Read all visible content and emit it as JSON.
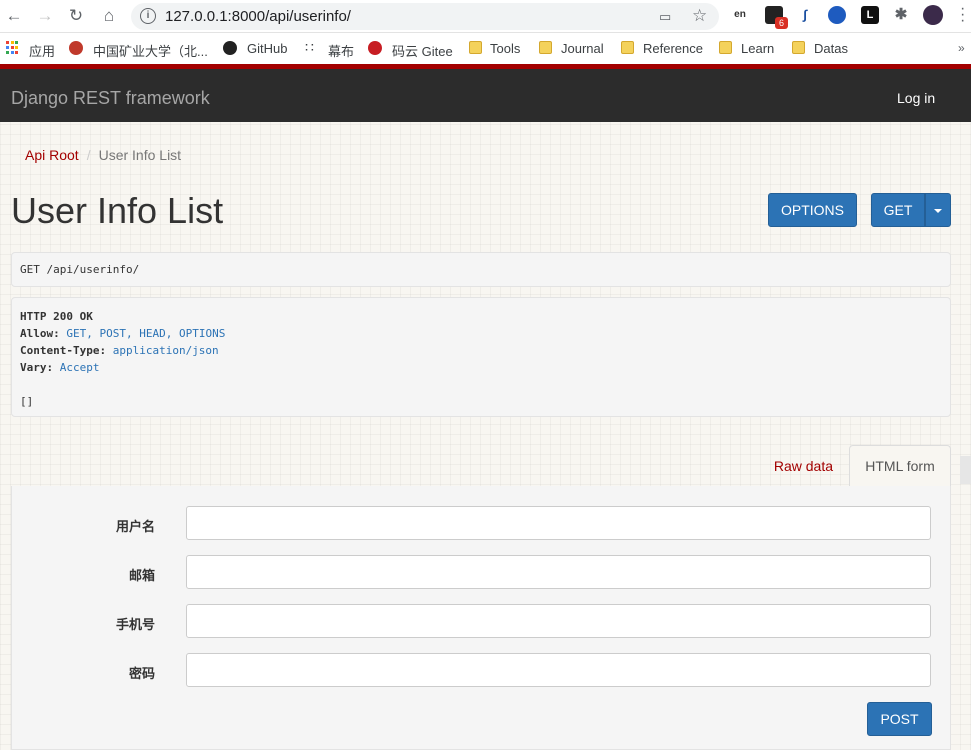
{
  "browser": {
    "url": "127.0.0.1:8000/api/userinfo/",
    "extension_badge": "6",
    "bookmarks": [
      "应用",
      "中国矿业大学（北...",
      "GitHub",
      "幕布",
      "码云 Gitee",
      "Tools",
      "Journal",
      "Reference",
      "Learn",
      "Datas"
    ]
  },
  "navbar": {
    "brand": "Django REST framework",
    "login": "Log in"
  },
  "breadcrumb": {
    "root": "Api Root",
    "separator": "/",
    "current": "User Info List"
  },
  "page_title": "User Info List",
  "buttons": {
    "options": "OPTIONS",
    "get": "GET",
    "post": "POST"
  },
  "request_line": "GET /api/userinfo/",
  "response": {
    "status": "HTTP 200 OK",
    "allow_key": "Allow:",
    "allow_val": "GET, POST, HEAD, OPTIONS",
    "ct_key": "Content-Type:",
    "ct_val": "application/json",
    "vary_key": "Vary:",
    "vary_val": "Accept",
    "body": "[]"
  },
  "tabs": {
    "raw": "Raw data",
    "html": "HTML form"
  },
  "form": {
    "fields": [
      {
        "label": "用户名",
        "value": ""
      },
      {
        "label": "邮箱",
        "value": ""
      },
      {
        "label": "手机号",
        "value": ""
      },
      {
        "label": "密码",
        "value": ""
      }
    ]
  },
  "colors": {
    "accent": "#a30000",
    "button": "#2c73b5",
    "navbar": "#2c2c2c"
  }
}
